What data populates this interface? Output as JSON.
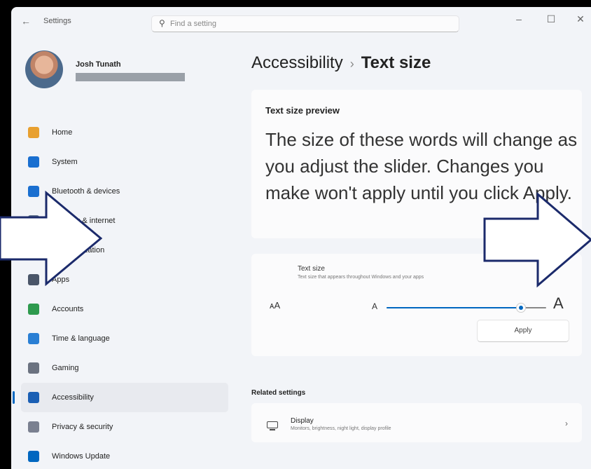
{
  "window": {
    "app_title": "Settings",
    "search_placeholder": "Find a setting",
    "minimize": "–",
    "maximize": "☐",
    "close": "✕",
    "back": "←"
  },
  "user": {
    "name": "Josh Tunath"
  },
  "nav": [
    {
      "label": "Home",
      "icon": "home-icon",
      "color": "#e8a030"
    },
    {
      "label": "System",
      "icon": "system-icon",
      "color": "#1a6fd0"
    },
    {
      "label": "Bluetooth & devices",
      "icon": "bluetooth-icon",
      "color": "#1a6fd0"
    },
    {
      "label": "Network & internet",
      "icon": "network-icon",
      "color": "#5b6e8a"
    },
    {
      "label": "Personalization",
      "icon": "personalization-icon",
      "color": "#c46b2a"
    },
    {
      "label": "Apps",
      "icon": "apps-icon",
      "color": "#4a5568"
    },
    {
      "label": "Accounts",
      "icon": "accounts-icon",
      "color": "#2e9a4e"
    },
    {
      "label": "Time & language",
      "icon": "time-language-icon",
      "color": "#2a7fd4"
    },
    {
      "label": "Gaming",
      "icon": "gaming-icon",
      "color": "#6b7280"
    },
    {
      "label": "Accessibility",
      "icon": "accessibility-icon",
      "color": "#1a5fb4",
      "active": true
    },
    {
      "label": "Privacy & security",
      "icon": "privacy-shield-icon",
      "color": "#7a8090"
    },
    {
      "label": "Windows Update",
      "icon": "windows-update-icon",
      "color": "#0067c0"
    }
  ],
  "breadcrumb": {
    "parent": "Accessibility",
    "separator": "›",
    "current": "Text size"
  },
  "preview": {
    "title": "Text size preview",
    "text": "The size of these words will change as you adjust the slider. Changes you make won't apply until you click Apply."
  },
  "text_size": {
    "title": "Text size",
    "description": "Text size that appears throughout Windows and your apps",
    "small_a": "A",
    "big_a": "A",
    "aa_icon": "ᴀA",
    "slider_fraction": 0.84,
    "apply_label": "Apply"
  },
  "related": {
    "heading": "Related settings",
    "display_title": "Display",
    "display_desc": "Monitors, brightness, night light, display profile"
  },
  "accent_color": "#0067c0"
}
